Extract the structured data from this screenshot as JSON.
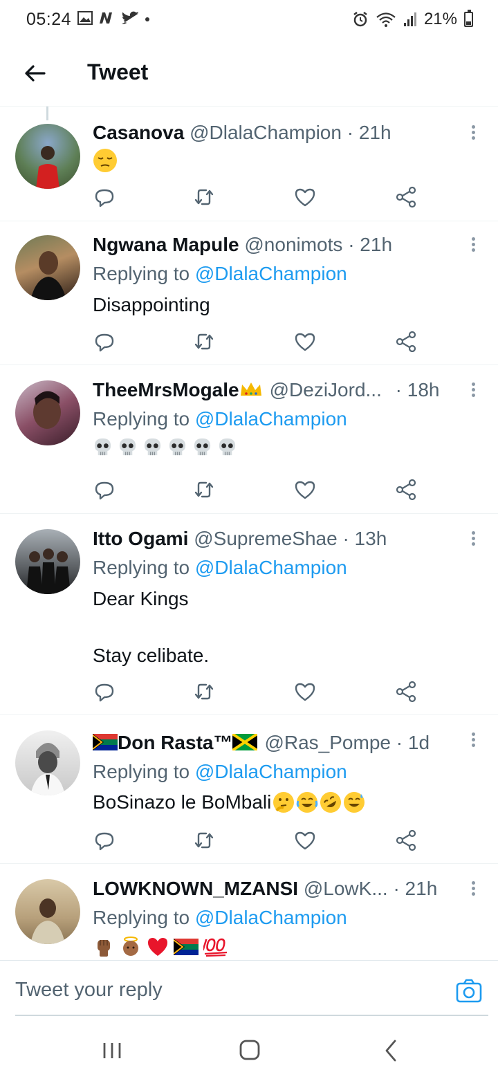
{
  "status_bar": {
    "time": "05:24",
    "battery": "21%"
  },
  "header": {
    "title": "Tweet"
  },
  "tweets": [
    {
      "name": "Casanova",
      "handle": "@DlalaChampion",
      "time": "· 21h",
      "reply_prefix": "",
      "reply_to": "",
      "text": ""
    },
    {
      "name": "Ngwana Mapule",
      "handle": "@nonimots",
      "time": "· 21h",
      "reply_prefix": "Replying to ",
      "reply_to": "@DlalaChampion",
      "text": "Disappointing"
    },
    {
      "name": "TheeMrsMogale",
      "handle": "@DeziJord...",
      "time": "· 18h",
      "reply_prefix": "Replying to ",
      "reply_to": "@DlalaChampion",
      "text": ""
    },
    {
      "name": "Itto Ogami",
      "handle": "@SupremeShae",
      "time": "· 13h",
      "reply_prefix": "Replying to ",
      "reply_to": "@DlalaChampion",
      "text": "Dear Kings\n\nStay celibate."
    },
    {
      "name": "Don Rasta™",
      "handle": "@Ras_Pompe",
      "time": "· 1d",
      "reply_prefix": "Replying to ",
      "reply_to": "@DlalaChampion",
      "text": "BoSinazo le BoMbali"
    },
    {
      "name": "LOWKNOWN_MZANSI",
      "handle": "@LowK...",
      "time": "· 21h",
      "reply_prefix": "Replying to ",
      "reply_to": "@DlalaChampion",
      "text": ""
    }
  ],
  "reply_bar": {
    "placeholder": "Tweet your reply"
  },
  "colors": {
    "link": "#1d9bf0",
    "secondary": "#536471",
    "icon": "#536471"
  }
}
